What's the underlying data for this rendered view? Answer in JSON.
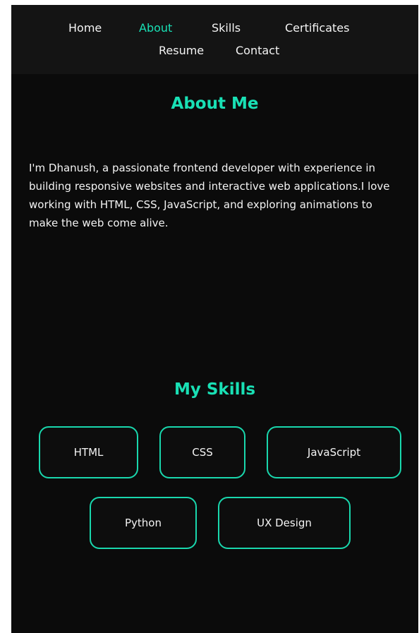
{
  "nav": {
    "items": [
      {
        "label": "Home",
        "active": false
      },
      {
        "label": "About",
        "active": true
      },
      {
        "label": "Skills",
        "active": false
      },
      {
        "label": "Certificates",
        "active": false
      },
      {
        "label": "Resume",
        "active": false
      },
      {
        "label": "Contact",
        "active": false
      }
    ]
  },
  "about": {
    "title": "About Me",
    "text": "I'm Dhanush, a passionate frontend developer with experience in building responsive websites and interactive web applications.I love working with HTML, CSS, JavaScript, and exploring animations to make the web come alive."
  },
  "skills": {
    "title": "My Skills",
    "items": [
      "HTML",
      "CSS",
      "JavaScript",
      "Python",
      "UX Design"
    ]
  },
  "colors": {
    "accent": "#19e0b5",
    "background": "#0b0b0b",
    "navbar": "#141414",
    "text": "#f4f4f4"
  }
}
